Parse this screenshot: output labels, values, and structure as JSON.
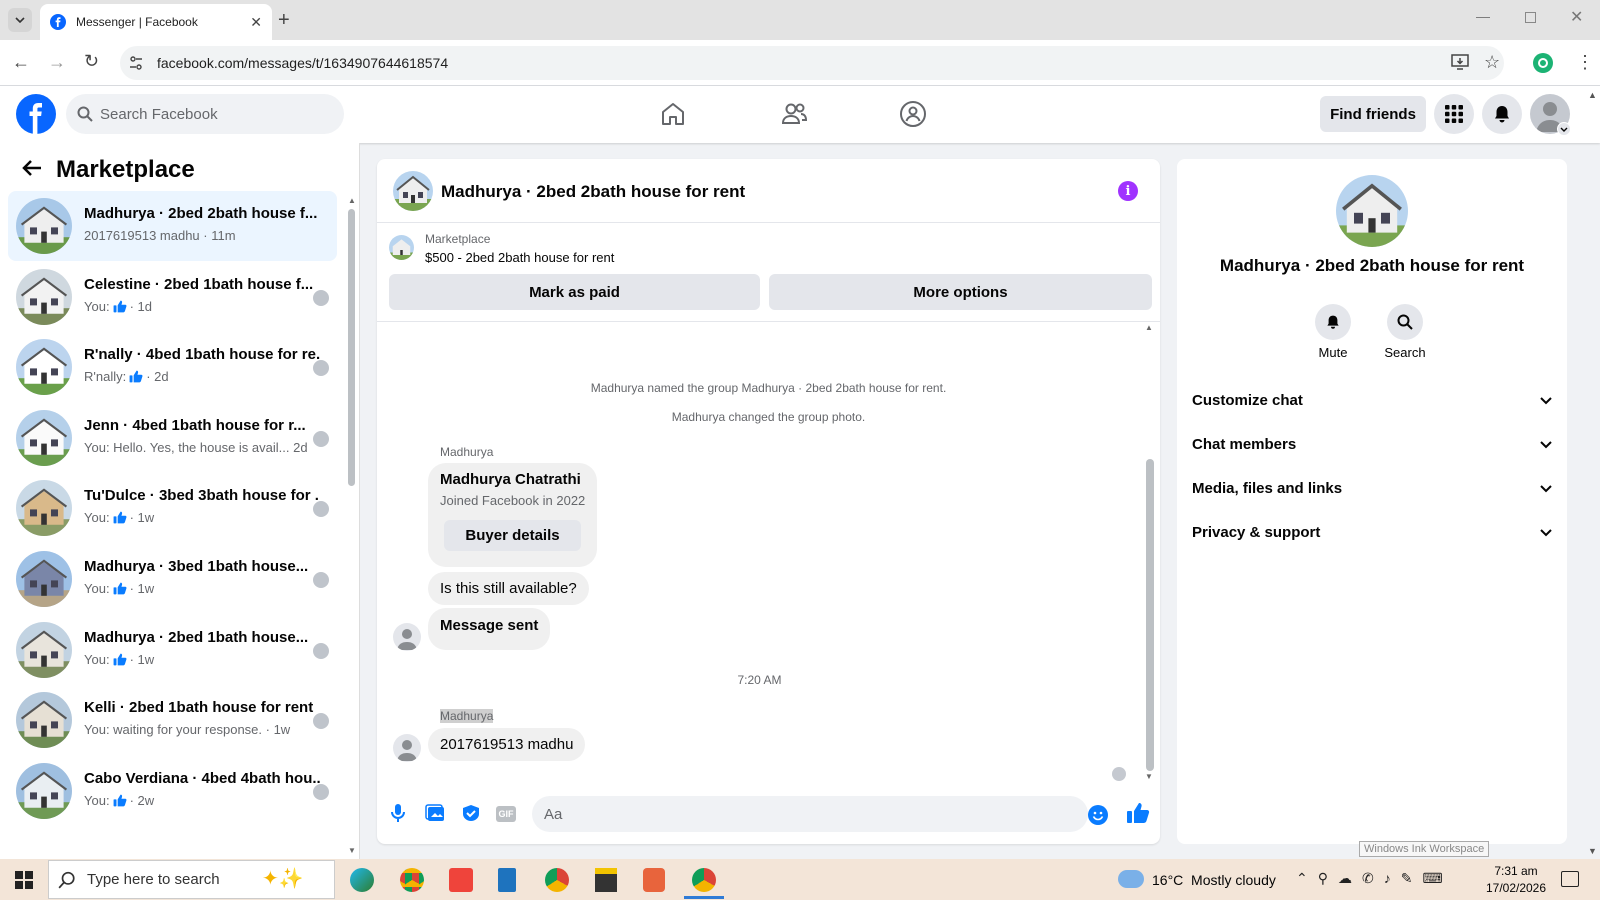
{
  "browser": {
    "tab_title": "Messenger | Facebook",
    "url": "facebook.com/messages/t/1634907644618574"
  },
  "fb_header": {
    "search_placeholder": "Search Facebook",
    "find_friends": "Find friends"
  },
  "sidebar": {
    "title": "Marketplace",
    "conversations": [
      {
        "title": "Madhurya · 2bed 2bath house f...",
        "sub": "2017619513 madhu · 11m",
        "like": false
      },
      {
        "title": "Celestine · 2bed 1bath house f...",
        "sub_prefix": "You:",
        "sub": "· 1d",
        "like": true
      },
      {
        "title": "R'nally · 4bed 1bath house for re...",
        "sub_prefix": "R'nally:",
        "sub": "· 2d",
        "like": true
      },
      {
        "title": "Jenn · 4bed 1bath house for r...",
        "sub": "You: Hello. Yes, the house is avail... 2d",
        "like": false
      },
      {
        "title": "Tu'Dulce · 3bed 3bath house for ...",
        "sub_prefix": "You:",
        "sub": "· 1w",
        "like": true
      },
      {
        "title": "Madhurya · 3bed 1bath house...",
        "sub_prefix": "You:",
        "sub": "· 1w",
        "like": true
      },
      {
        "title": "Madhurya · 2bed 1bath house...",
        "sub_prefix": "You:",
        "sub": "· 1w",
        "like": true
      },
      {
        "title": "Kelli · 2bed 1bath house for rent",
        "sub": "You: waiting for your response. · 1w",
        "like": false
      },
      {
        "title": "Cabo Verdiana · 4bed 4bath hou...",
        "sub_prefix": "You:",
        "sub": "· 2w",
        "like": true
      }
    ]
  },
  "chat": {
    "title": "Madhurya · 2bed 2bath house for rent",
    "listing_label": "Marketplace",
    "listing_price": "$500 - 2bed 2bath house for rent",
    "mark_paid": "Mark as paid",
    "more_options": "More options",
    "sys_1": "Madhurya named the group Madhurya · 2bed 2bath house for rent.",
    "sys_2": "Madhurya changed the group photo.",
    "sender_1": "Madhurya",
    "card_name": "Madhurya Chatrathi",
    "card_joined": "Joined Facebook in 2022",
    "buyer_details": "Buyer details",
    "msg_available": "Is this still available?",
    "msg_sent": "Message sent",
    "timestamp": "7:20 AM",
    "sender_2": "Madhurya",
    "msg_phone": "2017619513 madhu",
    "composer_placeholder": "Aa"
  },
  "details": {
    "title": "Madhurya · 2bed 2bath house for rent",
    "mute": "Mute",
    "search": "Search",
    "rows": [
      "Customize chat",
      "Chat members",
      "Media, files and links",
      "Privacy & support"
    ]
  },
  "taskbar": {
    "search_placeholder": "Type here to search",
    "weather": "16°C  Mostly cloudy",
    "time": "7:31 am",
    "date": "17/02/2026",
    "tooltip": "Windows Ink Workspace"
  },
  "colors": {
    "fb_blue": "#0866ff",
    "messenger_blue": "#0a7cff",
    "info_purple": "#a033ff"
  }
}
